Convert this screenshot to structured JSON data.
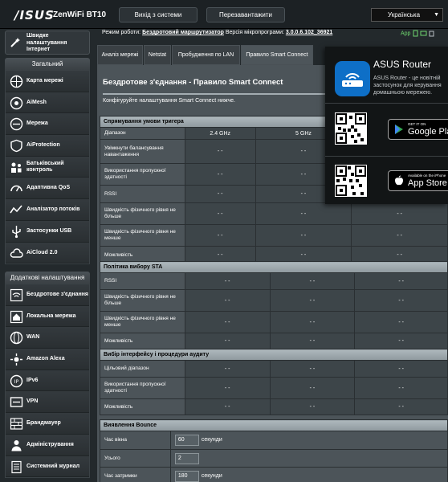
{
  "header": {
    "logo": "/ISUS",
    "model": "ZenWiFi BT10",
    "logout": "Вихід з системи",
    "reboot": "Перезавантажити",
    "language": "Українська"
  },
  "status": {
    "mode_label": "Режим роботи:",
    "mode_value": "Бездротовий маршрутизатор",
    "fw_label": "Версія мікропрограми:",
    "fw_value": "3.0.0.6.102_36921",
    "app": "App"
  },
  "sidebar": {
    "qis": "Швидке налаштування Інтернет",
    "general_title": "Загальний",
    "general": [
      {
        "label": "Карта мережі",
        "icon": "globe-icon"
      },
      {
        "label": "AiMesh",
        "icon": "aimesh-icon"
      },
      {
        "label": "Мережа",
        "icon": "network-icon"
      },
      {
        "label": "AiProtection",
        "icon": "shield-icon"
      },
      {
        "label": "Батьківський контроль",
        "icon": "family-icon"
      },
      {
        "label": "Адаптивна QoS",
        "icon": "speedometer-icon"
      },
      {
        "label": "Аналізатор потоків",
        "icon": "traffic-icon"
      },
      {
        "label": "Застосунки USB",
        "icon": "usb-icon"
      },
      {
        "label": "AiCloud 2.0",
        "icon": "cloud-icon"
      }
    ],
    "advanced_title": "Додаткові налаштування",
    "advanced": [
      {
        "label": "Бездротове з'єднання",
        "icon": "wifi-icon"
      },
      {
        "label": "Локальна мережа",
        "icon": "house-icon"
      },
      {
        "label": "WAN",
        "icon": "globe-icon"
      },
      {
        "label": "Amazon Alexa",
        "icon": "alexa-icon"
      },
      {
        "label": "IPv6",
        "icon": "ipv6-icon"
      },
      {
        "label": "VPN",
        "icon": "vpn-icon"
      },
      {
        "label": "Брандмауер",
        "icon": "firewall-icon"
      },
      {
        "label": "Адміністрування",
        "icon": "admin-icon"
      },
      {
        "label": "Системний журнал",
        "icon": "log-icon"
      }
    ]
  },
  "tabs": [
    {
      "label": "Аналіз мережі"
    },
    {
      "label": "Netstat"
    },
    {
      "label": "Пробудження по LAN"
    },
    {
      "label": "Правило Smart Connect"
    }
  ],
  "page": {
    "title": "Бездротове з'єднання - Правило Smart Connect",
    "description": "Конфігуруйте налаштування Smart Connect нижче."
  },
  "steering": {
    "header": "Спрямування умови тригера",
    "band_label": "Діапазон",
    "bands": [
      "2.4 GHz",
      "5 GHz",
      ""
    ],
    "rows": [
      {
        "label": "Увімкнути балансування навантаження",
        "values": [
          "- -",
          "- -",
          "- -"
        ]
      },
      {
        "label": "Використання пропускної здатності",
        "values": [
          "- -",
          "- -",
          "- -"
        ]
      },
      {
        "label": "RSSI",
        "values": [
          "- -",
          "- -",
          "- -"
        ]
      },
      {
        "label": "Швидкість фізичного рівня не більше",
        "values": [
          "- -",
          "- -",
          "- -"
        ]
      },
      {
        "label": "Швидкість фізичного рівня не менше",
        "values": [
          "- -",
          "- -",
          "- -"
        ]
      },
      {
        "label": "Можливість",
        "values": [
          "- -",
          "- -",
          "- -"
        ]
      }
    ]
  },
  "sta": {
    "header": "Політика вибору STA",
    "rows": [
      {
        "label": "RSSI",
        "values": [
          "- -",
          "- -",
          "- -"
        ]
      },
      {
        "label": "Швидкість фізичного рівня не більше",
        "values": [
          "- -",
          "- -",
          "- -"
        ]
      },
      {
        "label": "Швидкість фізичного рівня не менше",
        "values": [
          "- -",
          "- -",
          "- -"
        ]
      },
      {
        "label": "Можливість",
        "values": [
          "- -",
          "- -",
          "- -"
        ]
      }
    ]
  },
  "iface": {
    "header": "Вибір інтерфейсу і процедури аудиту",
    "rows": [
      {
        "label": "Цільовий діапазон",
        "values": [
          "- -",
          "- -",
          "- -"
        ]
      },
      {
        "label": "Використання пропускної здатності",
        "values": [
          "- -",
          "- -",
          "- -"
        ]
      },
      {
        "label": "Можливість",
        "values": [
          "- -",
          "- -",
          "- -"
        ]
      }
    ]
  },
  "bounce": {
    "header": "Виявлення Bounce",
    "rows": [
      {
        "label": "Час вікна",
        "value": "60",
        "unit": "секунди"
      },
      {
        "label": "Усього",
        "value": "2",
        "unit": ""
      },
      {
        "label": "Час затримки",
        "value": "180",
        "unit": "секунди"
      }
    ]
  },
  "popup": {
    "title": "ASUS Router",
    "text": "ASUS Router - це новітній застосунок для керування домашньою мережею.",
    "text_lines": [
      "ASUS Router - це новітній",
      "застосунок для керування",
      "домашньою мережею."
    ],
    "google_small": "GET IT ON",
    "google_big": "Google Play",
    "apple_small": "Available on the iPhone",
    "apple_big": "App Store"
  }
}
